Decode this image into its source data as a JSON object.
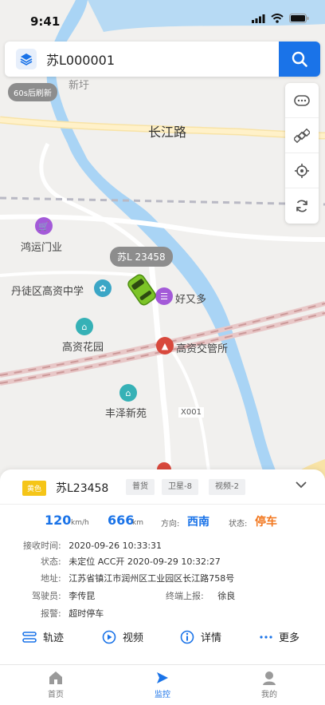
{
  "status_bar": {
    "time": "9:41"
  },
  "search": {
    "value": "苏L000001"
  },
  "refresh_chip": "60s后刷新",
  "map": {
    "labels": {
      "xinyu": "新圩",
      "changjiang_road": "长江路",
      "hongyun": "鸿运门业",
      "school": "丹徒区高资中学",
      "youyouduo": "好又多",
      "gaozi_garden": "高资花园",
      "police": "高资交管所",
      "fengze": "丰泽新苑",
      "x001": "X001"
    },
    "vehicle_plate": "苏L 23458"
  },
  "card": {
    "color_badge": "黄色",
    "plate": "苏L23458",
    "tags": [
      "普货",
      "卫星-8",
      "视频-2"
    ],
    "speed": "120",
    "speed_unit": "km/h",
    "mileage": "666",
    "mileage_unit": "km",
    "direction_label": "方向:",
    "direction": "西南",
    "state_label": "状态:",
    "state": "停车",
    "recv_time_label": "接收时间:",
    "recv_time": "2020-09-26 10:33:31",
    "status_label": "状态:",
    "status_text": "未定位 ACC开 2020-09-29 10:32:27",
    "address_label": "地址:",
    "address": "江苏省镇江市润州区工业园区长江路758号",
    "driver_label": "驾驶员:",
    "driver": "李传昆",
    "terminal_label": "终端上报:",
    "terminal": "徐良",
    "alarm_label": "报警:",
    "alarm": "超时停车",
    "actions": {
      "track": "轨迹",
      "video": "视频",
      "detail": "详情",
      "more": "更多"
    }
  },
  "tabs": [
    "首页",
    "监控",
    "我的"
  ],
  "colors": {
    "accent": "#1a73e8",
    "warning": "#f2771e",
    "badge": "#f5c518"
  }
}
